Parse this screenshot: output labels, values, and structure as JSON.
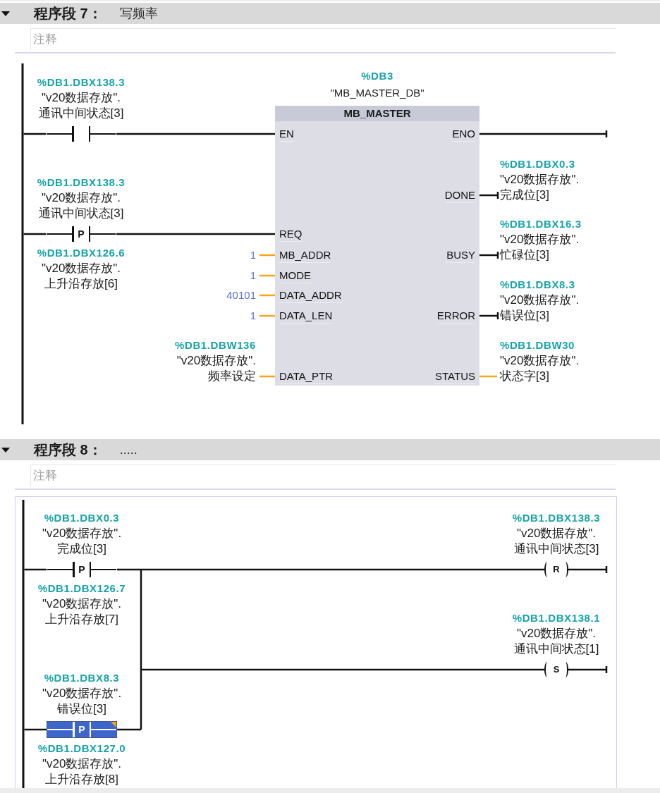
{
  "networks": [
    {
      "expanded": true,
      "heading": "程序段 7：",
      "title": "写频率",
      "comment": {
        "placeholder": "注释"
      },
      "selected": false,
      "contacts": [
        {
          "kind": "normally_open",
          "selected": false,
          "address": "%DB1.DBX138.3",
          "operand": [
            "\"v20数据存放\".",
            "通讯中间状态[3]"
          ]
        },
        {
          "kind": "positive_edge",
          "symbol": "P",
          "selected": false,
          "address": "%DB1.DBX138.3",
          "operand": [
            "\"v20数据存放\".",
            "通讯中间状态[3]"
          ],
          "edge_memory": {
            "address": "%DB1.DBX126.6",
            "operand": [
              "\"v20数据存放\".",
              "上升沿存放[6]"
            ]
          }
        }
      ],
      "block": {
        "instance_address": "%DB3",
        "instance_name": "\"MB_MASTER_DB\"",
        "name": "MB_MASTER",
        "inputs": [
          {
            "pin": "EN",
            "kind": "bool"
          },
          {
            "pin": "REQ",
            "kind": "bool"
          },
          {
            "pin": "MB_ADDR",
            "kind": "data",
            "constant": "1"
          },
          {
            "pin": "MODE",
            "kind": "data",
            "constant": "1"
          },
          {
            "pin": "DATA_ADDR",
            "kind": "data",
            "constant": "40101"
          },
          {
            "pin": "DATA_LEN",
            "kind": "data",
            "constant": "1"
          },
          {
            "pin": "DATA_PTR",
            "kind": "data",
            "address": "%DB1.DBW136",
            "operand": [
              "\"v20数据存放\".",
              "频率设定"
            ]
          }
        ],
        "outputs": [
          {
            "pin": "ENO",
            "kind": "bool"
          },
          {
            "pin": "DONE",
            "kind": "bool",
            "address": "%DB1.DBX0.3",
            "operand": [
              "\"v20数据存放\".",
              "完成位[3]"
            ]
          },
          {
            "pin": "BUSY",
            "kind": "bool",
            "address": "%DB1.DBX16.3",
            "operand": [
              "\"v20数据存放\".",
              "忙碌位[3]"
            ]
          },
          {
            "pin": "ERROR",
            "kind": "bool",
            "address": "%DB1.DBX8.3",
            "operand": [
              "\"v20数据存放\".",
              "错误位[3]"
            ]
          },
          {
            "pin": "STATUS",
            "kind": "data",
            "address": "%DB1.DBW30",
            "operand": [
              "\"v20数据存放\".",
              "状态字[3]"
            ]
          }
        ]
      }
    },
    {
      "expanded": true,
      "heading": "程序段 8：",
      "title": ".....",
      "comment": {
        "placeholder": "注释"
      },
      "selected": true,
      "contacts": [
        {
          "kind": "positive_edge",
          "symbol": "P",
          "selected": false,
          "address": "%DB1.DBX0.3",
          "operand": [
            "\"v20数据存放\".",
            "完成位[3]"
          ],
          "edge_memory": {
            "address": "%DB1.DBX126.7",
            "operand": [
              "\"v20数据存放\".",
              "上升沿存放[7]"
            ]
          }
        },
        {
          "kind": "positive_edge",
          "symbol": "P",
          "selected": true,
          "address": "%DB1.DBX8.3",
          "operand": [
            "\"v20数据存放\".",
            "错误位[3]"
          ],
          "edge_memory": {
            "address": "%DB1.DBX127.0",
            "operand": [
              "\"v20数据存放\".",
              "上升沿存放[8]"
            ]
          }
        }
      ],
      "coils": [
        {
          "symbol": "R",
          "address": "%DB1.DBX138.3",
          "operand": [
            "\"v20数据存放\".",
            "通讯中间状态[3]"
          ]
        },
        {
          "symbol": "S",
          "address": "%DB1.DBX138.1",
          "operand": [
            "\"v20数据存放\".",
            "通讯中间状态[1]"
          ]
        }
      ]
    }
  ]
}
